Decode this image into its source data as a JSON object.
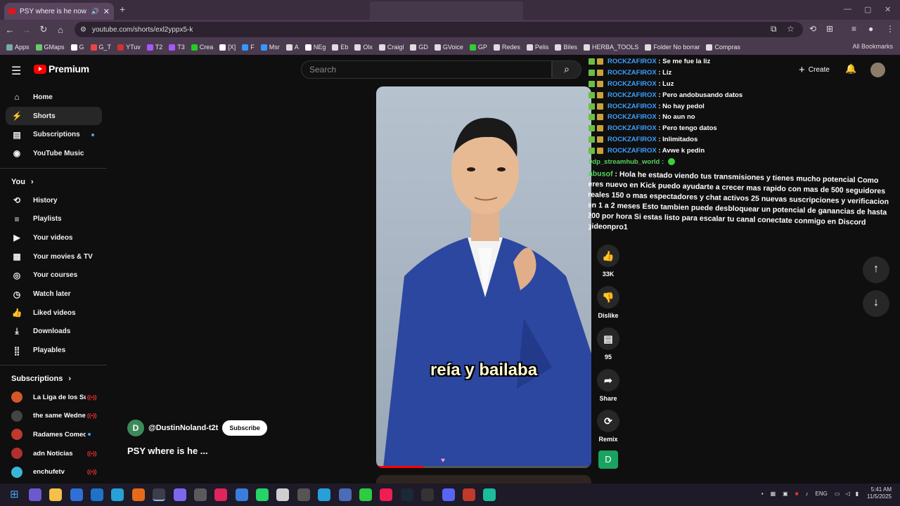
{
  "browser": {
    "tab_title": "PSY where is he now #fyp #",
    "url": "youtube.com/shorts/exl2yppx5-k",
    "bookmarks": [
      "Apps",
      "GMaps",
      "G",
      "G_T",
      "YTuv",
      "T2",
      "T3",
      "Crea",
      "[X]",
      "F",
      "Msr",
      "A",
      "NEg",
      "Eb",
      "Olx",
      "Craigl",
      "GD",
      "GVoice",
      "GP",
      "Redes",
      "Pelis",
      "Biles",
      "HERBA_TOOLS",
      "Folder No borrar",
      "Compras"
    ],
    "all_bookmarks": "All Bookmarks"
  },
  "youtube": {
    "brand": "Premium",
    "search_placeholder": "Search",
    "create_label": "Create",
    "nav_main": [
      "Home",
      "Shorts",
      "Subscriptions",
      "YouTube Music"
    ],
    "you_heading": "You",
    "nav_you": [
      "History",
      "Playlists",
      "Your videos",
      "Your movies & TV",
      "Your courses",
      "Watch later",
      "Liked videos",
      "Downloads",
      "Playables"
    ],
    "subscriptions_heading": "Subscriptions",
    "subscriptions": [
      {
        "name": "La Liga de los Sú...",
        "status": "live"
      },
      {
        "name": "the same Wedne...",
        "status": "live"
      },
      {
        "name": "Radames Comedy",
        "status": "dot"
      },
      {
        "name": "adn Noticias",
        "status": "live"
      },
      {
        "name": "enchufetv",
        "status": "live"
      }
    ],
    "caption": "reía y bailaba",
    "channel_handle": "@DustinNoland-t2t",
    "channel_initial": "D",
    "subscribe_label": "Subscribe",
    "video_title": "PSY where is he ...",
    "likes": "33K",
    "dislike_label": "Dislike",
    "comments": "95",
    "share_label": "Share",
    "remix_label": "Remix",
    "remix_avatar": "D",
    "progress_fraction": 0.22
  },
  "chat": {
    "top_line": "Se me fue la liz",
    "messages": [
      {
        "user": "ROCKZAFIROX",
        "text": ": Liz"
      },
      {
        "user": "ROCKZAFIROX",
        "text": ": Luz"
      },
      {
        "user": "ROCKZAFIROX",
        "text": ": Pero andobusando datos"
      },
      {
        "user": "ROCKZAFIROX",
        "text": ": No hay pedol"
      },
      {
        "user": "ROCKZAFIROX",
        "text": ": No aun no"
      },
      {
        "user": "ROCKZAFIROX",
        "text": ": Pero tengo datos"
      },
      {
        "user": "ROCKZAFIROX",
        "text": ": Inlimitados"
      },
      {
        "user": "ROCKZAFIROX",
        "text": ": Avwe k pedin"
      }
    ],
    "top_user": "ROCKZAFIROX",
    "streamhub_user": "0dp_streamhub_world :",
    "promo_user": "abusof",
    "promo_text": ": Hola he estado viendo tus transmisiones y tienes mucho potencial Como eres nuevo en Kick puedo ayudarte a crecer mas rapido con mas de 500 seguidores reales 150 o mas espectadores y chat activos 25 nuevas suscripciones y verificacion en 1 a 2 meses Esto tambien puede desbloquear un potencial de ganancias de hasta 200 por hora Si estas listo para escalar tu canal conectate conmigo en Discord gideonpro1"
  },
  "taskbar": {
    "lang": "ENG",
    "time": "5:41 AM",
    "date": "11/5/2025"
  }
}
